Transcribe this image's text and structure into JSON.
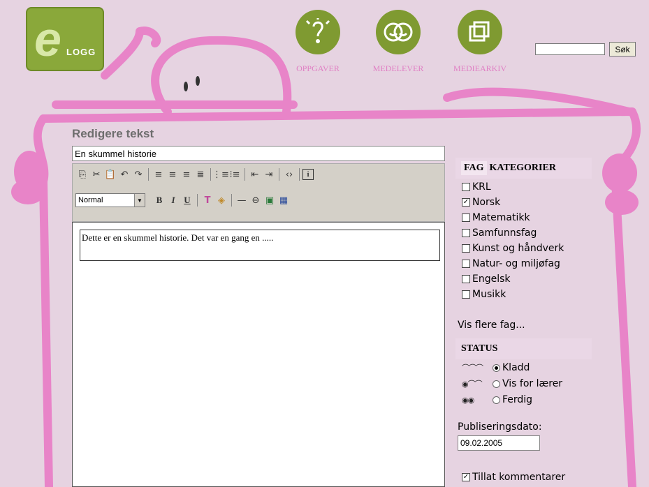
{
  "logo": {
    "text": "LOGG"
  },
  "nav": [
    {
      "label": "OPPGAVER",
      "icon": "question-bulb-icon"
    },
    {
      "label": "MEDELEVER",
      "icon": "classmates-icon"
    },
    {
      "label": "MEDIEARKIV",
      "icon": "media-archive-icon"
    }
  ],
  "search": {
    "value": "",
    "button": "Søk"
  },
  "editor": {
    "heading": "Redigere tekst",
    "title_value": "En skummel historie",
    "format_value": "Normal",
    "body_text": "Dette er en skummel historie. Det var en gang en ....."
  },
  "panel": {
    "tab_fag": "FAG",
    "tab_kategorier": "KATEGORIER",
    "subjects": [
      {
        "label": "KRL",
        "checked": false
      },
      {
        "label": "Norsk",
        "checked": true
      },
      {
        "label": "Matematikk",
        "checked": false
      },
      {
        "label": "Samfunnsfag",
        "checked": false
      },
      {
        "label": "Kunst og håndverk",
        "checked": false
      },
      {
        "label": "Natur- og miljøfag",
        "checked": false
      },
      {
        "label": "Engelsk",
        "checked": false
      },
      {
        "label": "Musikk",
        "checked": false
      }
    ],
    "more_subjects": "Vis flere fag...",
    "status_heading": "STATUS",
    "status_options": [
      {
        "label": "Kladd",
        "selected": true
      },
      {
        "label": "Vis for lærer",
        "selected": false
      },
      {
        "label": "Ferdig",
        "selected": false
      }
    ],
    "pub_label": "Publiseringsdato:",
    "pub_value": "09.02.2005",
    "allow_comments": "Tillat kommentarer"
  },
  "colors": {
    "pink": "#e884c8",
    "green": "#7f9a31",
    "background": "#e6d3e1"
  }
}
